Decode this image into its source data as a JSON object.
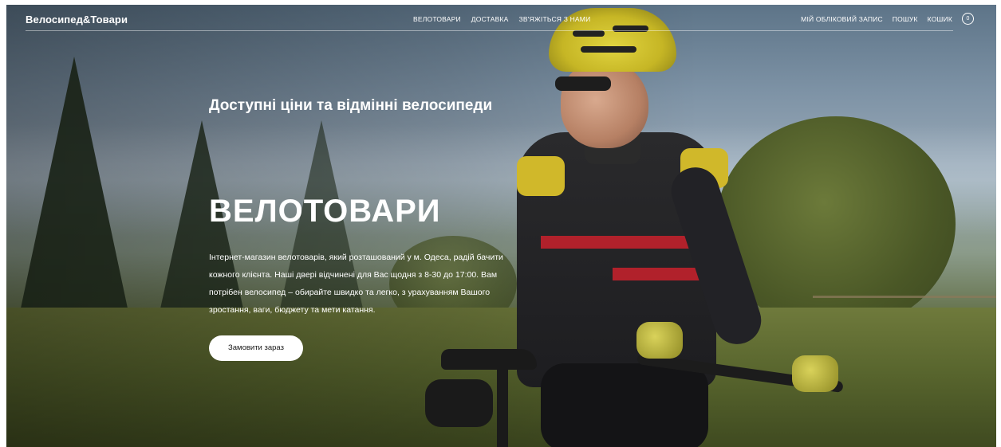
{
  "header": {
    "logo": "Велосипед&Товари",
    "nav": [
      "ВЕЛОТОВАРИ",
      "ДОСТАВКА",
      "ЗВ'ЯЖІТЬСЯ З НАМИ"
    ],
    "account": "МІЙ ОБЛІКОВИЙ ЗАПИС",
    "search": "ПОШУК",
    "cart": "КОШИК",
    "cart_count": "0"
  },
  "hero": {
    "tagline": "Доступні ціни та відмінні велосипеди",
    "title": "ВЕЛОТОВАРИ",
    "description": "Інтернет-магазин велотоварів, який розташований у м. Одеса, радій бачити кожного клієнта. Наші двері відчинені для Вас щодня з 8-30 до 17:00. Вам потрібен велосипед – обирайте швидко та легко, з урахуванням Вашого зростання, ваги, бюджету та мети катання.",
    "cta": "Замовити зараз"
  },
  "colors": {
    "text": "#ffffff",
    "button_bg": "#ffffff",
    "button_text": "#1a1a1a",
    "helmet": "#c6b625",
    "jersey_stripe": "#b1212b"
  }
}
